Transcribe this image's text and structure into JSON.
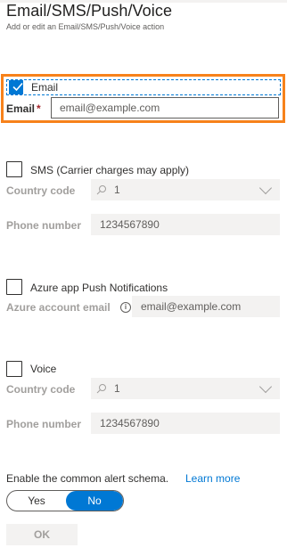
{
  "header": {
    "title": "Email/SMS/Push/Voice",
    "subtitle": "Add or edit an Email/SMS/Push/Voice action"
  },
  "email": {
    "checkbox_label": "Email",
    "checked": true,
    "field_label": "Email",
    "required_mark": "*",
    "placeholder": "email@example.com"
  },
  "sms": {
    "checkbox_label": "SMS (Carrier charges may apply)",
    "checked": false,
    "country_label": "Country code",
    "country_value": "1",
    "phone_label": "Phone number",
    "phone_value": "1234567890"
  },
  "push": {
    "checkbox_label": "Azure app Push Notifications",
    "checked": false,
    "account_label": "Azure account email",
    "account_value": "email@example.com"
  },
  "voice": {
    "checkbox_label": "Voice",
    "checked": false,
    "country_label": "Country code",
    "country_value": "1",
    "phone_label": "Phone number",
    "phone_value": "1234567890"
  },
  "schema": {
    "text": "Enable the common alert schema.",
    "learn_more": "Learn more",
    "toggle_yes": "Yes",
    "toggle_no": "No",
    "selected": "No"
  },
  "footer": {
    "ok_label": "OK"
  },
  "icons": {
    "search": "search-icon",
    "chevron": "chevron-down-icon",
    "info": "info-icon",
    "check": "checkmark-icon"
  },
  "colors": {
    "accent": "#0078d4",
    "highlight": "#f7821b",
    "required": "#a4262c",
    "disabled_bg": "#f3f2f1"
  }
}
